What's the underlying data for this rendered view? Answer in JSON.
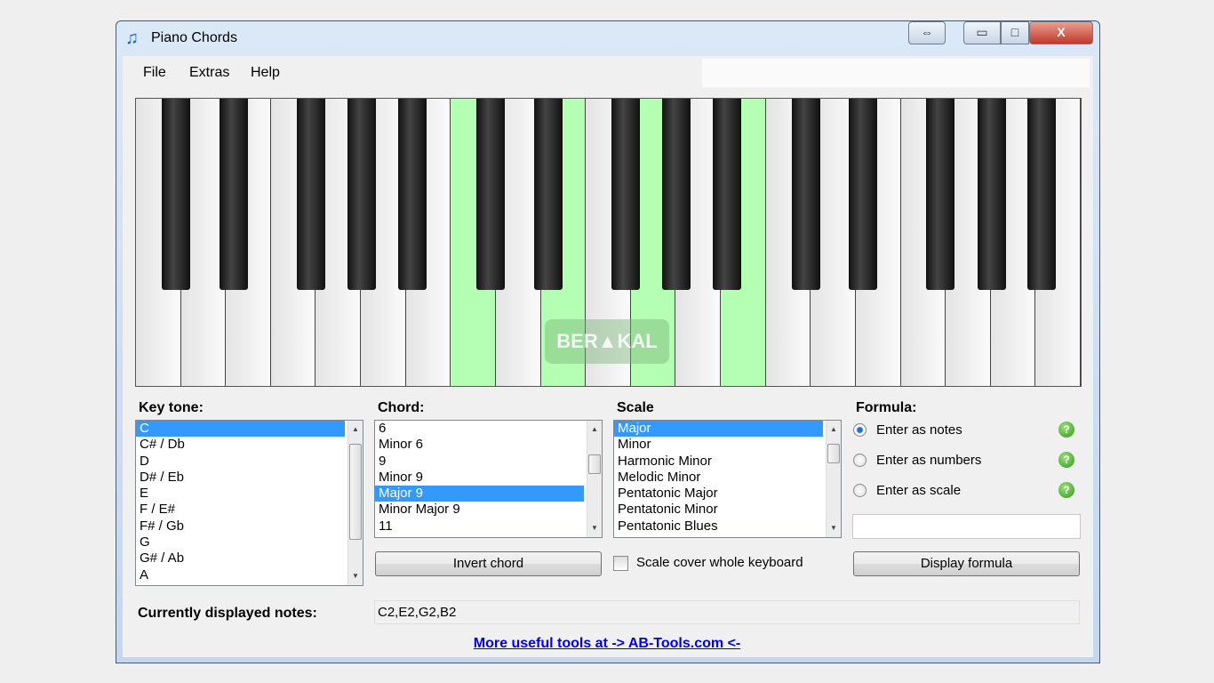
{
  "window": {
    "title": "Piano Chords",
    "icon": "music-note-icon"
  },
  "menu": [
    "File",
    "Extras",
    "Help"
  ],
  "keyboard": {
    "white_keys": [
      "C",
      "D",
      "E",
      "F",
      "G",
      "A",
      "B",
      "C",
      "D",
      "E",
      "F",
      "G",
      "A",
      "B",
      "C",
      "D",
      "E",
      "F",
      "G",
      "A",
      "B"
    ],
    "highlighted": [
      "C2",
      "E2",
      "G2",
      "B2"
    ],
    "highlight_color": "#b4ffb4"
  },
  "watermark": "BERAKAL",
  "keytone": {
    "label": "Key tone:",
    "items": [
      "C",
      "C# / Db",
      "D",
      "D# / Eb",
      "E",
      "F / E#",
      "F# / Gb",
      "G",
      "G# / Ab",
      "A"
    ],
    "selected": "C"
  },
  "chord": {
    "label": "Chord:",
    "items": [
      "6",
      "Minor 6",
      "9",
      "Minor 9",
      "Major 9",
      "Minor Major 9",
      "11"
    ],
    "selected": "Major 9",
    "button": "Invert chord"
  },
  "scale": {
    "label": "Scale",
    "items": [
      "Major",
      "Minor",
      "Harmonic Minor",
      "Melodic Minor",
      "Pentatonic Major",
      "Pentatonic Minor",
      "Pentatonic Blues"
    ],
    "selected": "Major",
    "checkbox": "Scale cover whole keyboard",
    "checked": false
  },
  "formula": {
    "label": "Formula:",
    "options": [
      "Enter as notes",
      "Enter as numbers",
      "Enter as scale"
    ],
    "selected": "Enter as notes",
    "value": "",
    "button": "Display formula"
  },
  "current": {
    "label": "Currently displayed notes:",
    "value": "C2,E2,G2,B2"
  },
  "link": "More useful tools at -> AB-Tools.com <-"
}
